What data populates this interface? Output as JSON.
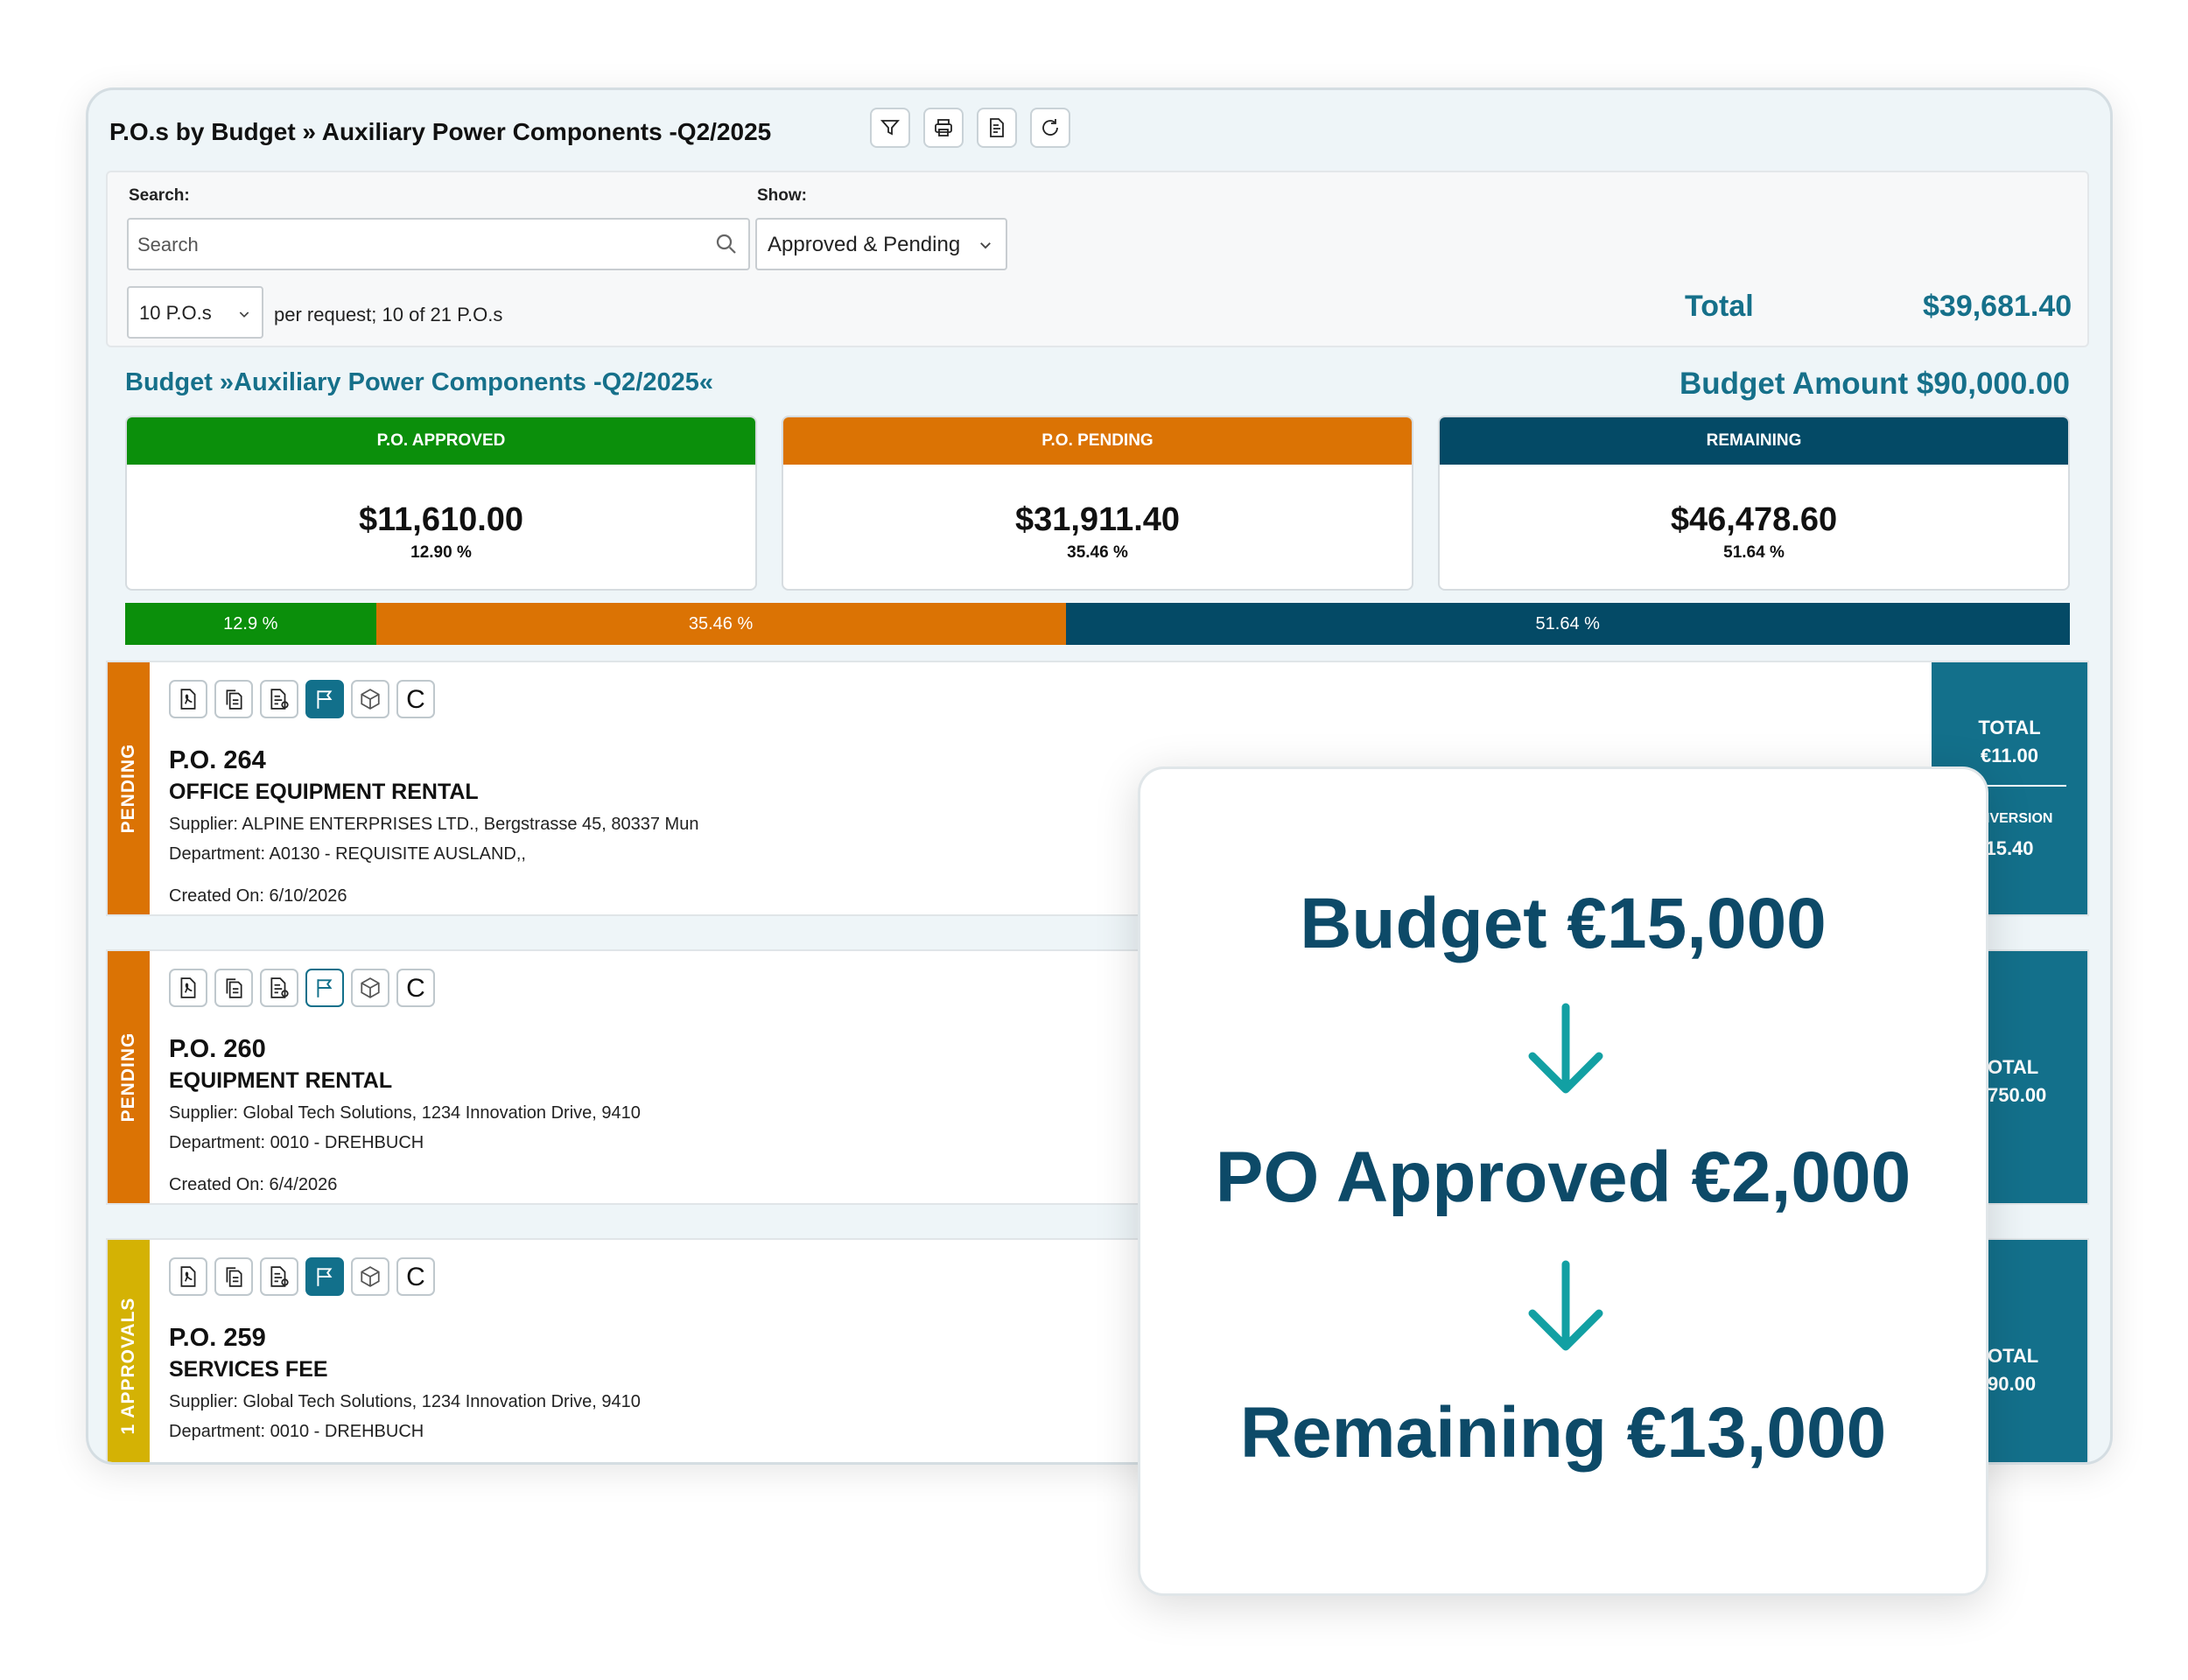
{
  "window": {
    "title": "P.O.s by Budget » Auxiliary Power Components -Q2/2025"
  },
  "filters": {
    "search_label": "Search:",
    "search_placeholder": "Search",
    "show_label": "Show:",
    "show_value": "Approved & Pending",
    "per_request_value": "10 P.O.s",
    "per_request_info": "per request; 10 of 21 P.O.s",
    "total_label": "Total",
    "total_value": "$39,681.40"
  },
  "budget": {
    "title": "Budget »Auxiliary Power Components -Q2/2025«",
    "amount": "Budget Amount $90,000.00",
    "cards": [
      {
        "label": "P.O. APPROVED",
        "amount": "$11,610.00",
        "percent": "12.90 %",
        "color": "#0b8f0b"
      },
      {
        "label": "P.O. PENDING",
        "amount": "$31,911.40",
        "percent": "35.46 %",
        "color": "#db7304"
      },
      {
        "label": "REMAINING",
        "amount": "$46,478.60",
        "percent": "51.64 %",
        "color": "#044a66"
      }
    ],
    "progress": [
      {
        "label": "12.9 %",
        "value": 12.9,
        "color": "#0b8f0b"
      },
      {
        "label": "35.46 %",
        "value": 35.46,
        "color": "#db7304"
      },
      {
        "label": "51.64 %",
        "value": 51.64,
        "color": "#044a66"
      }
    ]
  },
  "po_rows": [
    {
      "status": "PENDING",
      "status_color": "#db7304",
      "number": "P.O. 264",
      "name": "OFFICE EQUIPMENT RENTAL",
      "supplier": "Supplier: ALPINE ENTERPRISES LTD., Bergstrasse 45, 80337 Mun",
      "department": "Department: A0130 - REQUISITE AUSLAND,,",
      "created": "Created On: 6/10/2026",
      "total_label": "TOTAL",
      "total_value": "€11.00",
      "conversion_label": "IVERSION",
      "conversion_value": "15.40",
      "flag_active": true
    },
    {
      "status": "PENDING",
      "status_color": "#db7304",
      "number": "P.O. 260",
      "name": "EQUIPMENT RENTAL",
      "supplier": "Supplier: Global Tech Solutions, 1234 Innovation Drive, 9410",
      "department": "Department: 0010 - DREHBUCH",
      "created": "Created On: 6/4/2026",
      "total_label": "OTAL",
      "total_value": "750.00",
      "flag_active": false
    },
    {
      "status": "1 APPROVALS",
      "status_color": "#d4b204",
      "number": "P.O. 259",
      "name": "SERVICES FEE",
      "supplier": "Supplier: Global Tech Solutions, 1234 Innovation Drive, 9410",
      "department": "Department: 0010 - DREHBUCH",
      "total_label": "OTAL",
      "total_value": "90.00",
      "flag_active": true
    }
  ],
  "overlay": {
    "line1": "Budget €15,000",
    "line2": "PO Approved €2,000",
    "line3": "Remaining €13,000",
    "arrow_color": "#12a0a3"
  }
}
